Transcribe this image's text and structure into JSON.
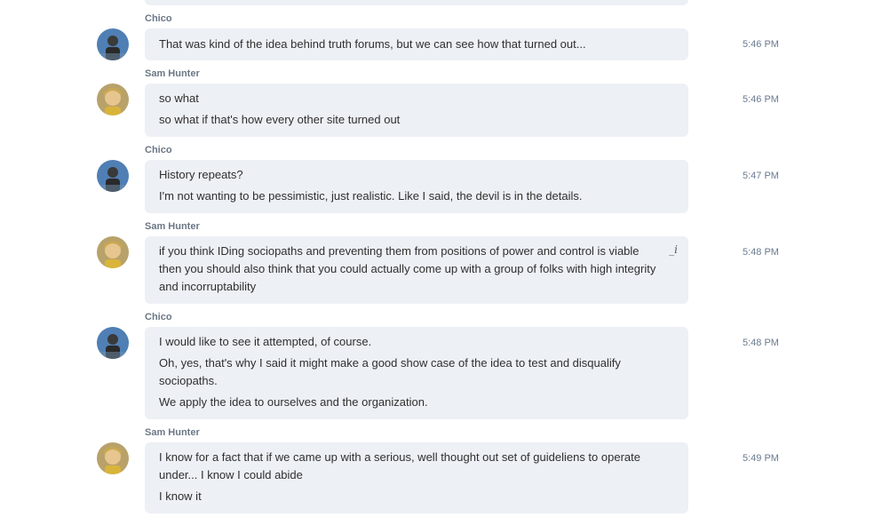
{
  "messages": [
    {
      "sender": "Chico",
      "time": "5:46 PM",
      "lines": [
        "That was kind of the idea behind truth forums, but we can see how that turned out..."
      ]
    },
    {
      "sender": "Sam Hunter",
      "time": "5:46 PM",
      "lines": [
        "so what",
        "so what if that's how every other site turned out"
      ]
    },
    {
      "sender": "Chico",
      "time": "5:47 PM",
      "lines": [
        "History repeats?",
        "I'm not wanting to be pessimistic, just realistic.  Like I said, the devil is in the details."
      ]
    },
    {
      "sender": "Sam Hunter",
      "time": "5:48 PM",
      "lines": [
        "if you think IDing sociopaths and preventing them from positions of power and control is viable then you should also think that you could actually come up with a group of folks with high integrity and incorruptability"
      ]
    },
    {
      "sender": "Chico",
      "time": "5:48 PM",
      "lines": [
        "I would like to see it attempted, of course.",
        "Oh, yes, that's why I said it might make a good show case of the idea to test and disqualify sociopaths.",
        "We apply the idea to ourselves and the organization."
      ]
    },
    {
      "sender": "Sam Hunter",
      "time": "5:49 PM",
      "lines": [
        "I know for a fact that if we came up with a serious, well thought out set of guideliens to operate under...   I know I could abide",
        "I know it"
      ]
    }
  ],
  "icons": {
    "edit": "edit-pencil-icon"
  },
  "colors": {
    "bubble": "#edf0f5",
    "sender": "#6b7785",
    "time": "#6a7a90"
  }
}
